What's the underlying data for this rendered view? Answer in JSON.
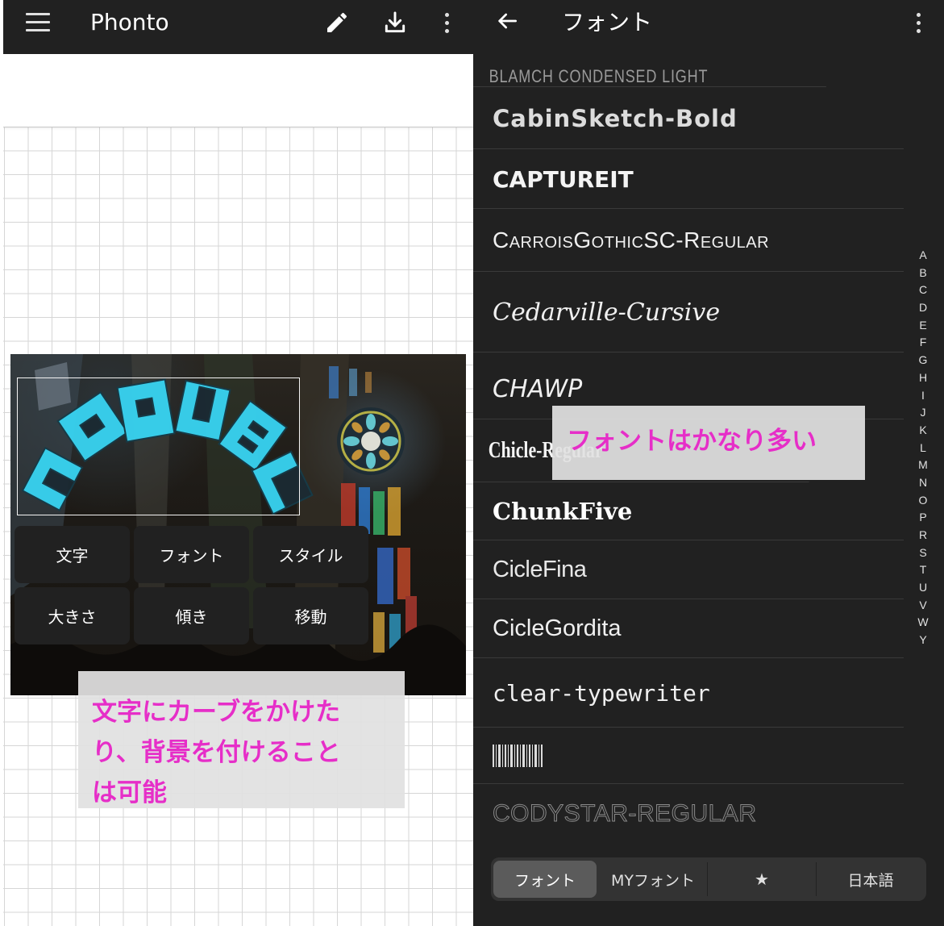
{
  "left": {
    "app_title": "Phonto",
    "icons": {
      "menu": "hamburger-menu-icon",
      "edit": "pencil-icon",
      "download": "download-icon",
      "more": "more-vert-icon"
    },
    "photo_text": "TRAVEL",
    "edit_buttons": {
      "text": "文字",
      "font": "フォント",
      "style": "スタイル",
      "size": "大きさ",
      "tilt": "傾き",
      "move": "移動"
    },
    "note_lines": [
      "文字にカーブをかけた",
      "り、背景を付けること",
      "は可能"
    ]
  },
  "right": {
    "title": "フォント",
    "icons": {
      "back": "arrow-back-icon",
      "more": "more-vert-icon"
    },
    "fonts": [
      "BLAMCH CONDENSED LIGHT",
      "CabinSketch-Bold",
      "CAPTUREIT",
      "CarroisGothicSC-Regular",
      "Cedarville-Cursive",
      "CHAWP",
      "Chicle-Regular",
      "ChunkFive",
      "CicleFina",
      "CicleGordita",
      "clear-typewriter",
      "CODYSTAR-REGULAR"
    ],
    "index_letters": [
      "A",
      "B",
      "C",
      "D",
      "E",
      "F",
      "G",
      "H",
      "I",
      "J",
      "K",
      "L",
      "M",
      "N",
      "O",
      "P",
      "R",
      "S",
      "T",
      "U",
      "V",
      "W",
      "Y"
    ],
    "note": "フォントはかなり多い",
    "tabs": {
      "font": "フォント",
      "my_font": "MYフォント",
      "favorites": "★",
      "japanese": "日本語"
    }
  },
  "colors": {
    "app_bar": "#212121",
    "annotation_text": "#e62ec8",
    "annotation_box": "#e1e1e1",
    "curved_text": "#38d4f2",
    "active_tab": "#5b5b5b"
  }
}
